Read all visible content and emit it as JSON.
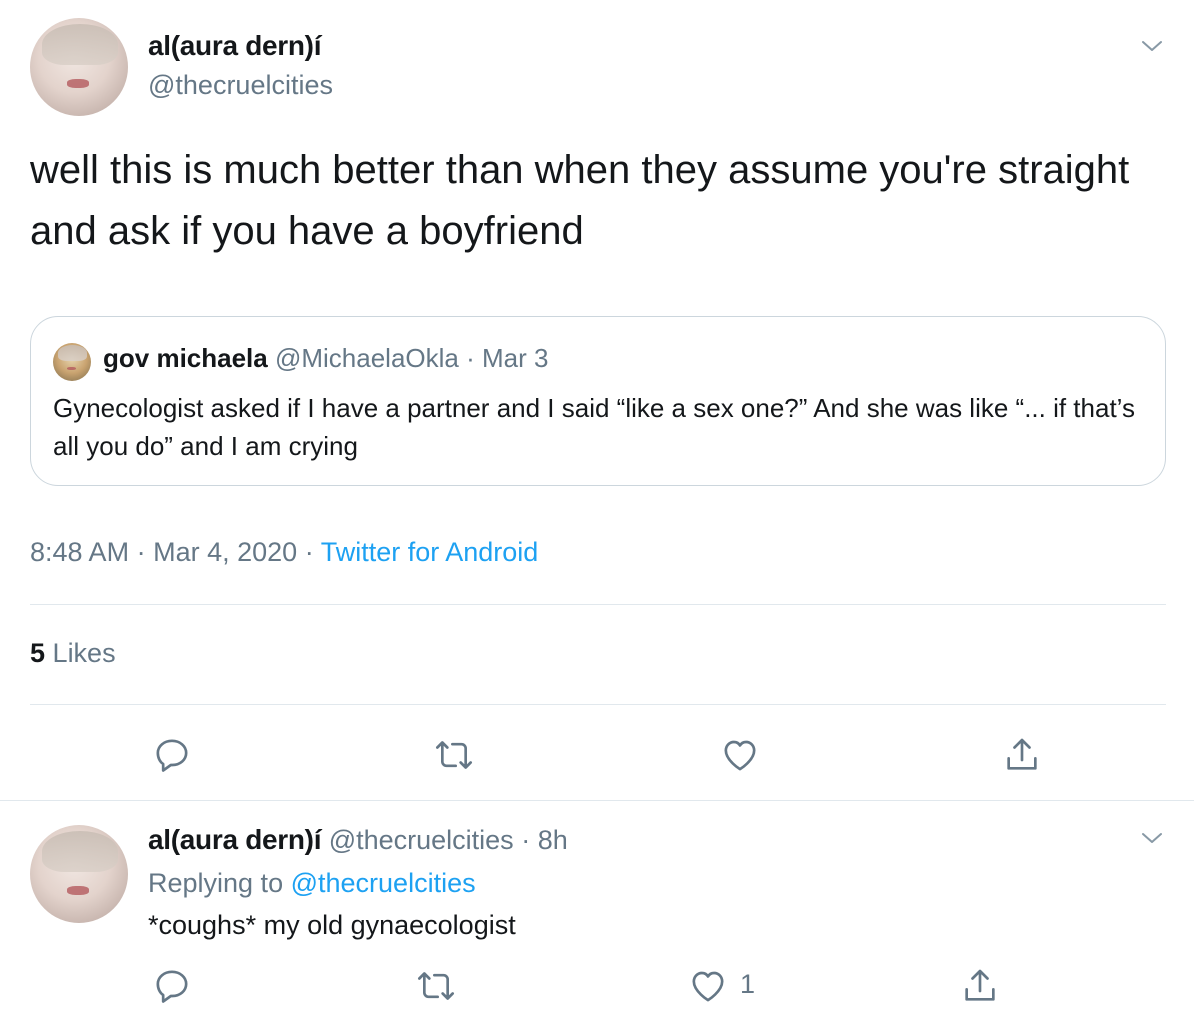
{
  "tweet": {
    "display_name": "al(aura dern)í",
    "handle": "@thecruelcities",
    "text": "well this is much better than when they assume you're straight and ask if you have a boyfriend",
    "quote": {
      "display_name": "gov michaela",
      "handle": "@MichaelaOkla",
      "separator": "·",
      "date": "Mar 3",
      "text": "Gynecologist asked if I have a partner and I said “like a sex one?” And she was like “... if that’s all you do” and I am crying"
    },
    "time": "8:48 AM",
    "date": "Mar 4, 2020",
    "meta_separator": "·",
    "source": "Twitter for Android",
    "likes_count": "5",
    "likes_label": "Likes"
  },
  "reply": {
    "display_name": "al(aura dern)í",
    "handle": "@thecruelcities",
    "separator": "·",
    "age": "8h",
    "replying_prefix": "Replying to",
    "replying_to": "@thecruelcities",
    "text": "*coughs* my old gynaecologist",
    "like_count": "1"
  },
  "icons": {
    "reply": "reply-icon",
    "retweet": "retweet-icon",
    "like": "heart-icon",
    "share": "share-icon",
    "more": "chevron-down-icon"
  },
  "colors": {
    "text": "#14171a",
    "secondary": "#657786",
    "link": "#1da1f2",
    "border": "#e1e8ed"
  }
}
